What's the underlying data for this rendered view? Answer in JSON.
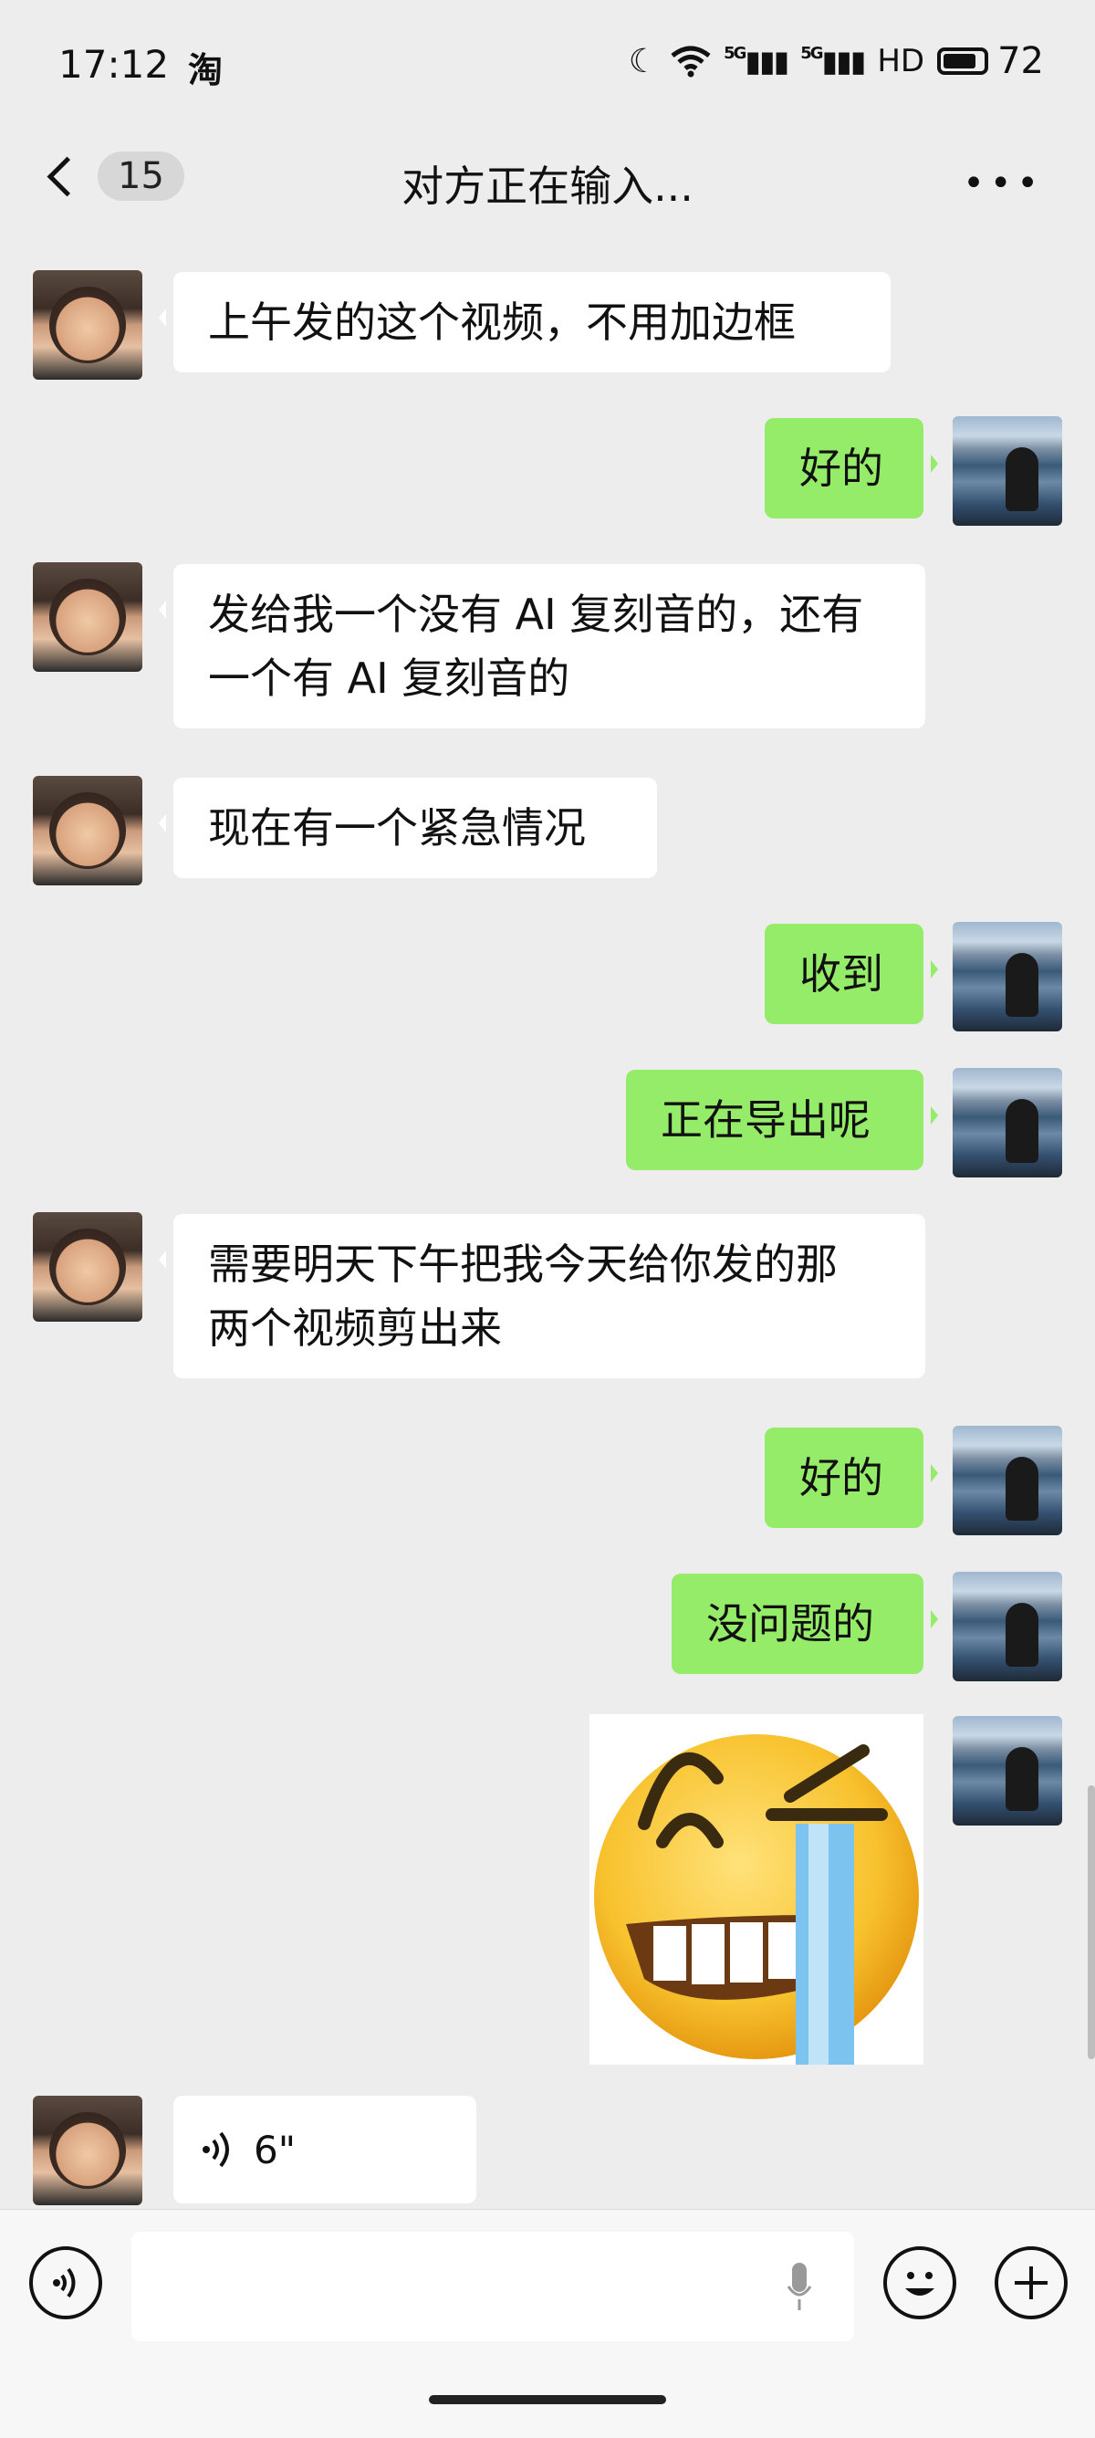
{
  "status_bar": {
    "time": "17:12",
    "app_icon_text": "淘",
    "signal_1": "5G",
    "signal_2": "5G",
    "hd": "HD",
    "battery": "72"
  },
  "nav": {
    "unread_count": "15",
    "title": "对方正在输入...",
    "more": "•••"
  },
  "messages": [
    {
      "side": "in",
      "text": "上午发的这个视频，不用加边框"
    },
    {
      "side": "out",
      "text": "好的"
    },
    {
      "side": "in",
      "text": "发给我一个没有 AI 复刻音的，还有\n一个有 AI 复刻音的"
    },
    {
      "side": "in",
      "text": "现在有一个紧急情况"
    },
    {
      "side": "out",
      "text": "收到"
    },
    {
      "side": "out",
      "text": "正在导出呢"
    },
    {
      "side": "in",
      "text": "需要明天下午把我今天给你发的那\n两个视频剪出来"
    },
    {
      "side": "out",
      "text": "好的"
    },
    {
      "side": "out",
      "text": "没问题的"
    },
    {
      "side": "out",
      "type": "sticker",
      "icon": "grin-crying-emoji-icon"
    },
    {
      "side": "in",
      "type": "voice",
      "duration": "6\""
    }
  ],
  "input": {
    "placeholder": ""
  },
  "colors": {
    "background": "#ededed",
    "outgoing_bubble": "#95ec69",
    "incoming_bubble": "#ffffff"
  }
}
